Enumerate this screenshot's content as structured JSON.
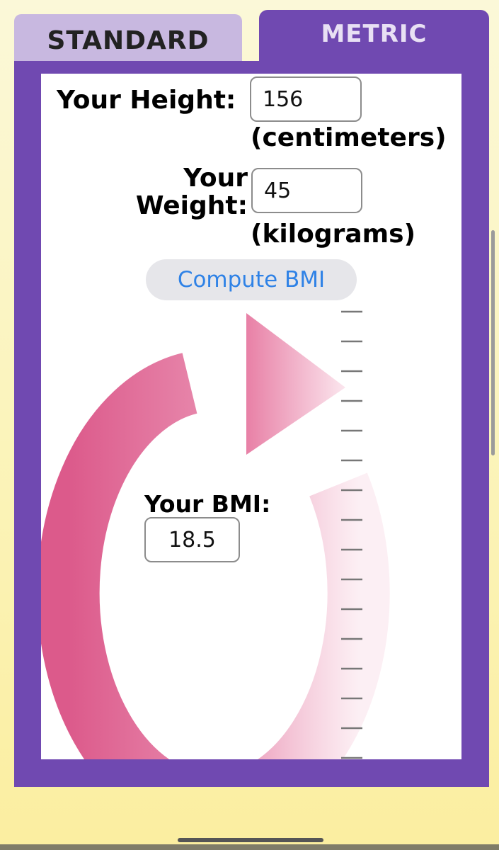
{
  "tabs": {
    "standard_label": "STANDARD",
    "metric_label": "METRIC",
    "active": "METRIC"
  },
  "height": {
    "label": "Your Height:",
    "value": "156",
    "unit": "(centimeters)"
  },
  "weight": {
    "label_line1": "Your",
    "label_line2": "Weight:",
    "value": "45",
    "unit": "(kilograms)"
  },
  "compute_button": {
    "label": "Compute BMI"
  },
  "result": {
    "label": "Your BMI:",
    "value": "18.5"
  },
  "colors": {
    "frame": "#7049b1",
    "inactive_tab": "#c8b8e0",
    "button_text": "#2f82e6",
    "arrow": "#e0608e",
    "background": "#fbf3b6"
  },
  "icons": {
    "arrow": "circular-arrow-icon",
    "ruler": "ruler-ticks-icon"
  }
}
